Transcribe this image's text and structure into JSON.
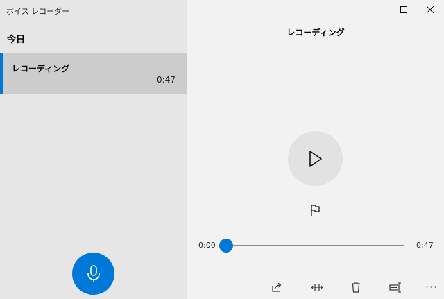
{
  "app": {
    "title": "ボイス レコーダー"
  },
  "sidebar": {
    "section_header": "今日",
    "recordings": [
      {
        "name": "レコーディング",
        "duration": "0:47",
        "selected": true
      }
    ],
    "record_button_icon": "microphone-icon"
  },
  "window_controls": [
    "minimize-icon",
    "maximize-icon",
    "close-icon"
  ],
  "player": {
    "title": "レコーディング",
    "play_icon": "play-icon",
    "flag_icon": "flag-icon",
    "time_current": "0:00",
    "time_total": "0:47",
    "progress": 0
  },
  "toolbar": {
    "icons": [
      "share-icon",
      "trim-icon",
      "delete-icon",
      "rename-icon",
      "more-icon"
    ]
  },
  "colors": {
    "accent": "#0078d7",
    "sidebar_bg": "#e6e6e6",
    "selected_bg": "#cccccc",
    "main_bg": "#f2f2f2"
  }
}
